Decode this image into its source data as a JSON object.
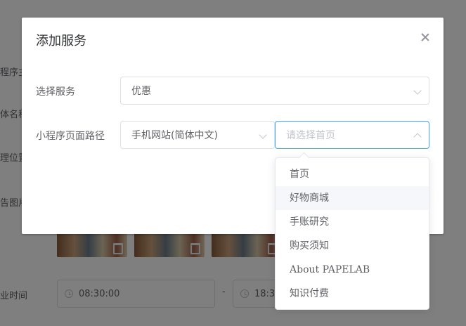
{
  "background": {
    "labels": [
      "程序主",
      "体名称",
      "理位置",
      "告图片",
      "业时间"
    ],
    "time_start": "08:30:00",
    "time_end": "18:3",
    "time_separator": "-"
  },
  "dialog": {
    "title": "添加服务",
    "service": {
      "label": "选择服务",
      "value": "优惠"
    },
    "page_path": {
      "label": "小程序页面路径",
      "site_value": "手机网站(简体中文)",
      "page_placeholder": "请选择首页"
    }
  },
  "dropdown": {
    "options": [
      "首页",
      "好物商城",
      "手账研究",
      "购买须知",
      "About PAPELAB",
      "知识付费"
    ]
  },
  "colors": {
    "focus_border": "#409eff",
    "hover_bg": "#f5f7fa",
    "text": "#606266",
    "placeholder": "#c0c4cc"
  }
}
